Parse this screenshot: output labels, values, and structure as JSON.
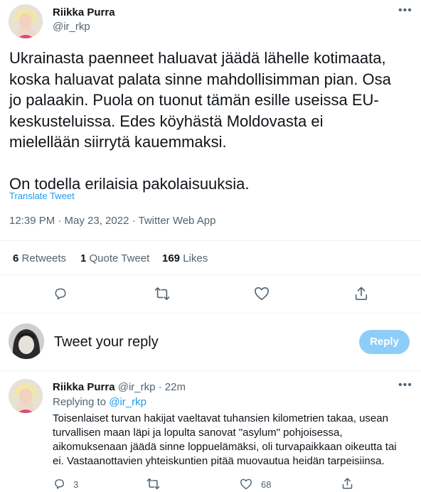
{
  "main_tweet": {
    "author_name": "Riikka Purra",
    "author_handle": "@ir_rkp",
    "text_lines": [
      "Ukrainasta paenneet haluavat jäädä lähelle kotimaata,",
      "koska haluavat palata sinne mahdollisimman pian. Osa",
      "jo palaakin. Puola on tuonut tämän esille useissa EU-",
      "keskusteluissa. Edes köyhästä Moldovasta ei",
      "mielellään siirrytä kauemmaksi.",
      "On todella erilaisia pakolaisuuksia."
    ],
    "translate_label": "Translate Tweet",
    "timestamp": "12:39 PM · May 23, 2022 · Twitter Web App",
    "stats": {
      "retweets_count": "6",
      "retweets_label": "Retweets",
      "quotes_count": "1",
      "quotes_label": "Quote Tweet",
      "likes_count": "169",
      "likes_label": "Likes"
    }
  },
  "reply_box": {
    "placeholder": "Tweet your reply",
    "button_label": "Reply"
  },
  "reply_tweet": {
    "author_name": "Riikka Purra",
    "author_handle": "@ir_rkp",
    "time": "· 22m",
    "replying_prefix": "Replying to",
    "replying_handle": "@ir_rkp",
    "text_lines": [
      "Toisenlaiset turvan hakijat vaeltavat tuhansien kilometrien takaa, usean",
      "turvallisen maan läpi ja lopulta sanovat \"asylum\" pohjoisessa,",
      "aikomuksenaan jäädä sinne loppuelämäksi, oli turvapaikkaan oikeutta tai",
      "ei. Vastaanottavien yhteiskuntien pitää muovautua heidän tarpeisiinsa."
    ],
    "reply_count": "3",
    "like_count": "68"
  },
  "colors": {
    "accent": "#1d9bf0",
    "reply_button": "#8ecdf8",
    "muted": "#536471"
  }
}
